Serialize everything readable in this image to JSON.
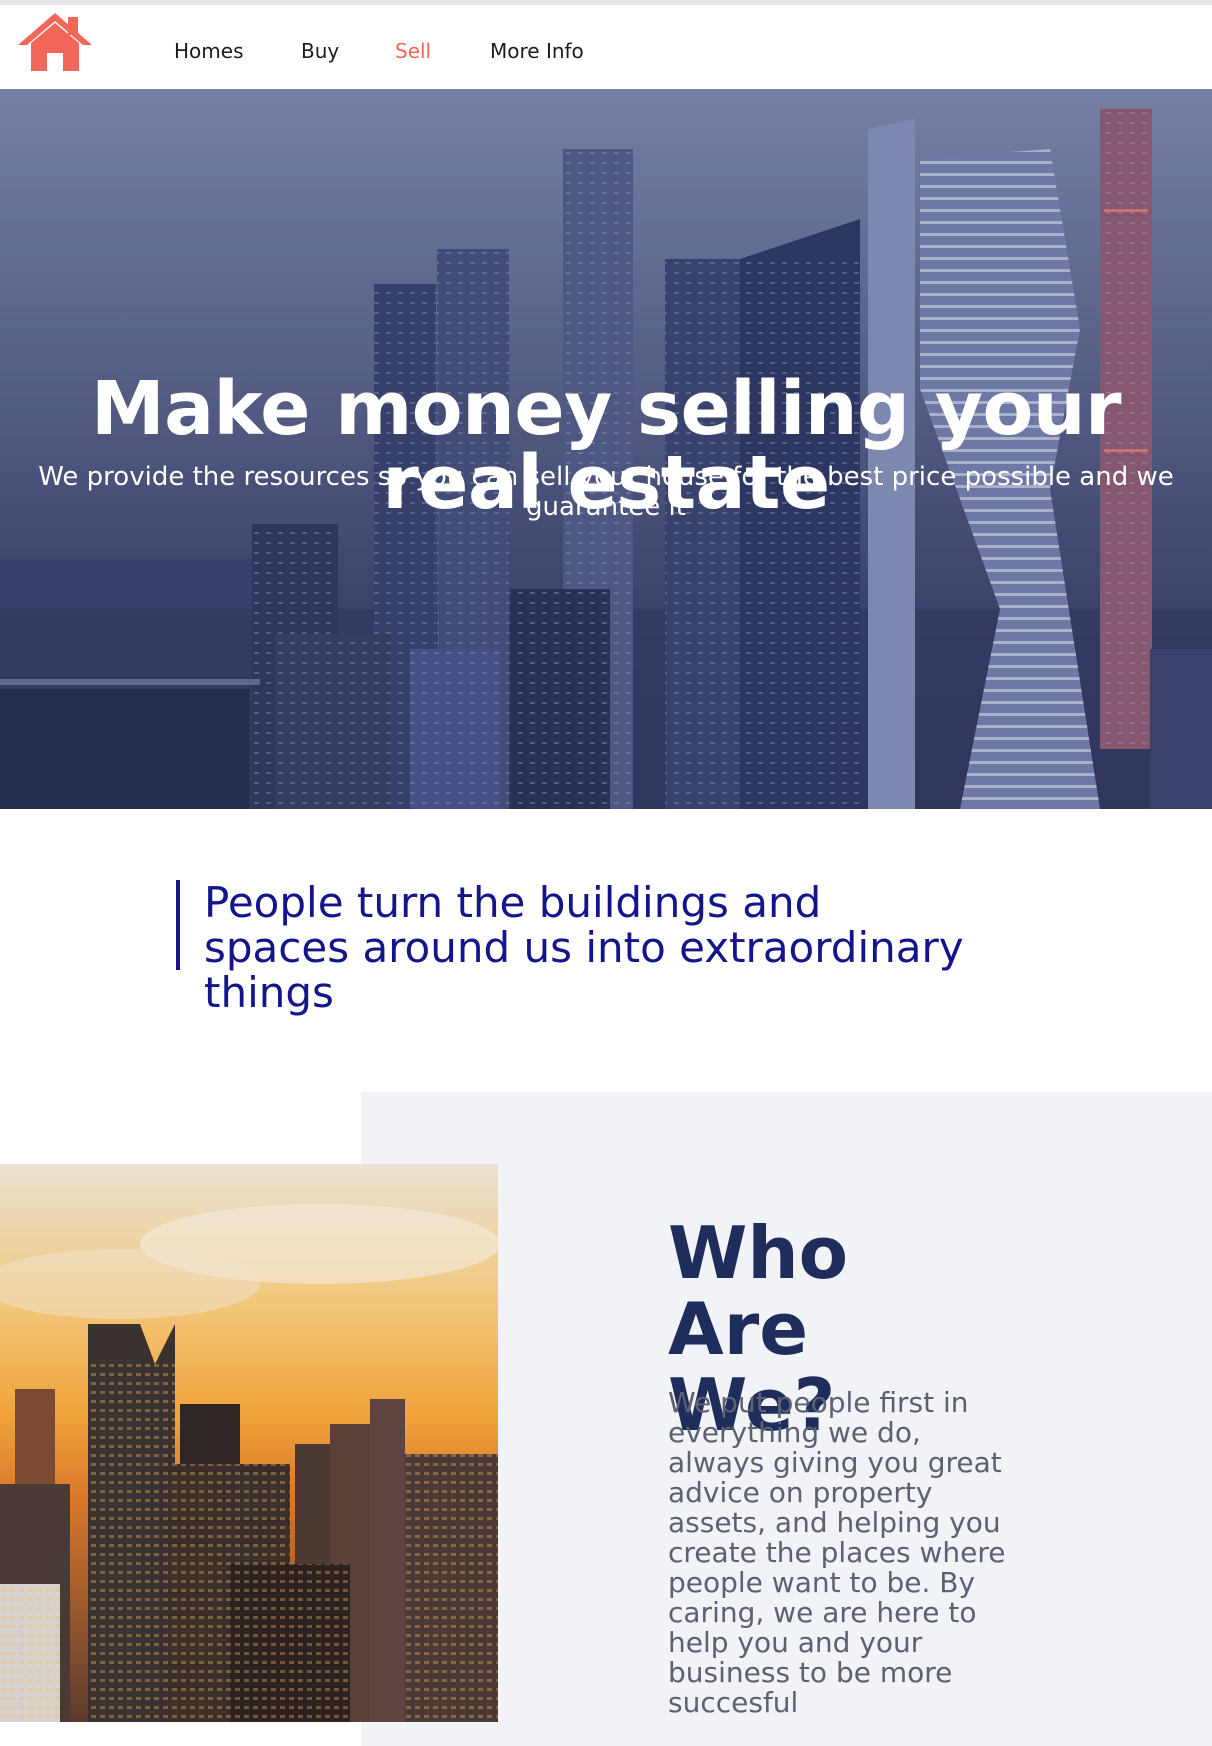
{
  "nav": {
    "logo_icon": "house-icon",
    "links": [
      {
        "label": "Homes",
        "active": false
      },
      {
        "label": "Buy",
        "active": false
      },
      {
        "label": "Sell",
        "active": true
      },
      {
        "label": "More Info",
        "active": false
      }
    ]
  },
  "hero": {
    "title": "Make money selling your real estate",
    "subtitle": "We provide the resources so you can sell your house for the best price possible and we guarantee it"
  },
  "quote": {
    "text": "People turn the buildings and spaces around us into extraordinary things"
  },
  "about": {
    "title": "Who Are We?",
    "text": "We put people first in everything we do, always giving you great advice on property assets, and helping you create the places where people want to be. By caring, we are here to help you and your business to be more succesful"
  },
  "colors": {
    "accent": "#f2675a",
    "quote": "#14158a",
    "heading": "#1f2d5c",
    "body_text": "#5e6170",
    "section_bg": "#f2f3f6"
  }
}
